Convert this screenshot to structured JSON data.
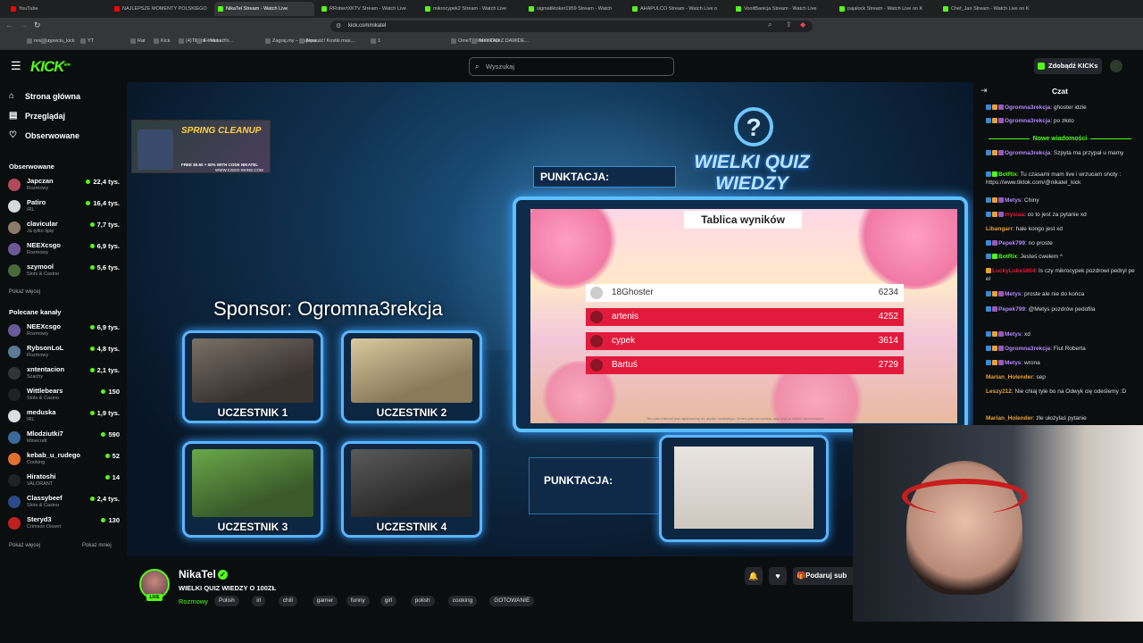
{
  "browser": {
    "tabs": [
      {
        "label": "YouTube",
        "color": "#ff0000"
      },
      {
        "label": "NAJLEPSZE MOMENTY POLSKIEGO",
        "color": "#ff0000"
      },
      {
        "label": "NikaTel Stream - Watch Live",
        "color": "#53fc18",
        "active": true
      },
      {
        "label": "RRobertXKTV Stream - Watch Live",
        "color": "#53fc18"
      },
      {
        "label": "mikrocypek2 Stream - Watch Live",
        "color": "#53fc18"
      },
      {
        "label": "sigmatiktoker1959 Stream - Watch",
        "color": "#53fc18"
      },
      {
        "label": "AHAPULCO Stream - Watch Live o",
        "color": "#53fc18"
      },
      {
        "label": "VooitBanicja Stream - Watch Live",
        "color": "#53fc18"
      },
      {
        "label": "pajalock Stream - Watch Live on K",
        "color": "#53fc18"
      },
      {
        "label": "Chef_Jan Stream - Watch Live on K",
        "color": "#53fc18"
      }
    ],
    "url": "kick.com/nikatel",
    "bookmarks": [
      "nowciu_",
      "nowciu_kick",
      "YT",
      "Rat",
      "Kick",
      "(4)TikTok - Make Yo...",
      "Filman.cc",
      "Zagraj.my – Najlepa...",
      "Nowość! Kostki mas...",
      "1",
      "OmeTV Video Chat...",
      "WYWIAD Z DAWIDE..."
    ]
  },
  "header": {
    "logo": "KICK",
    "logo_sup": "BETA",
    "search_placeholder": "Wyszukaj",
    "kicks_button": "Zdobądź KICKs"
  },
  "sidebar": {
    "nav": [
      {
        "label": "Strona główna",
        "icon": "home-icon"
      },
      {
        "label": "Przeglądaj",
        "icon": "browse-icon"
      },
      {
        "label": "Obserwowane",
        "icon": "heart-icon"
      }
    ],
    "followed_title": "Obserwowane",
    "followed": [
      {
        "name": "Japczan",
        "category": "Rozmowy",
        "viewers": "22,4 tys.",
        "color": "#b04a5a"
      },
      {
        "name": "Patiro",
        "category": "IRL",
        "viewers": "16,4 tys.",
        "color": "#d8d8d8"
      },
      {
        "name": "clavicular",
        "category": "Ja tylko śpię",
        "viewers": "7,7 tys.",
        "color": "#8a7a6a"
      },
      {
        "name": "NEEXcsgo",
        "category": "Rozmowy",
        "viewers": "6,9 tys.",
        "color": "#6a5a9a"
      },
      {
        "name": "szymool",
        "category": "Slots & Casino",
        "viewers": "5,6 tys.",
        "color": "#4a6a3a"
      }
    ],
    "show_more": "Pokaż więcej",
    "recommended_title": "Polecane kanały",
    "recommended": [
      {
        "name": "NEEXcsgo",
        "category": "Rozmowy",
        "viewers": "6,9 tys.",
        "color": "#6a5a9a"
      },
      {
        "name": "RybsonLoL",
        "category": "Rozmowy",
        "viewers": "4,8 tys.",
        "color": "#5a7a9a"
      },
      {
        "name": "xntentacion",
        "category": "Szachy",
        "viewers": "2,1 tys.",
        "color": "#333"
      },
      {
        "name": "Wittlebears",
        "category": "Slots & Casino",
        "viewers": "150",
        "color": "#222"
      },
      {
        "name": "meduska",
        "category": "IRL",
        "viewers": "1,9 tys.",
        "color": "#ddd"
      },
      {
        "name": "Mlodziutki7",
        "category": "Minecraft",
        "viewers": "590",
        "color": "#3a6a9a"
      },
      {
        "name": "kebab_u_rudego",
        "category": "Cooking",
        "viewers": "52",
        "color": "#e07030"
      },
      {
        "name": "Hiratoshi",
        "category": "VALORANT",
        "viewers": "14",
        "color": "#222"
      },
      {
        "name": "Classybeef",
        "category": "Slots & Casino",
        "viewers": "2,4 tys.",
        "color": "#2a4a8a"
      },
      {
        "name": "Steryd3",
        "category": "Crimson Desert",
        "viewers": "130",
        "color": "#c02020"
      }
    ],
    "show_more2": "Pokaż więcej",
    "show_less": "Pokaż mniej"
  },
  "video": {
    "promo_title": "SPRING CLEANUP",
    "promo_line1": "FREE $0.50 + 50% WITH CODE NIKATEL",
    "promo_line2": "WWW.CSGO-SKINS.COM",
    "sponsor": "Sponsor: Ogromna3rekcja",
    "quiz_title": "WIELKI QUIZ WIEDZY",
    "quiz_q": "?",
    "punktacja_1": "PUNKTACJA:",
    "punktacja_2": "PUNKTACJA:",
    "board_title": "Tablica wyników",
    "board_note": "Ten plan Kahoot! jest ograniczony do użytku osobistego. Zmień plan na wyższy, aby użyć w celach biznesowych",
    "leaderboard": [
      {
        "name": "18Ghoster",
        "score": "6234",
        "bg": "#ffffff",
        "fg": "#333333"
      },
      {
        "name": "artenis",
        "score": "4252",
        "bg": "#e21b3c",
        "fg": "#ffffff"
      },
      {
        "name": "cypek",
        "score": "3614",
        "bg": "#e21b3c",
        "fg": "#ffffff"
      },
      {
        "name": "Bartuś",
        "score": "2729",
        "bg": "#e21b3c",
        "fg": "#ffffff"
      }
    ],
    "contestants": [
      "UCZESTNIK 1",
      "UCZESTNIK 2",
      "UCZESTNIK 3",
      "UCZESTNIK 4"
    ]
  },
  "stream": {
    "name": "NikaTel",
    "title": "WIELKI QUIZ WIEDZY O 100ZŁ",
    "category": "Rozmowy",
    "tags": [
      "Polish",
      "irl",
      "chill",
      "gamer",
      "funny",
      "girl",
      "polish",
      "cooking",
      "GOTOWANIE"
    ],
    "live": "LIVE",
    "sub_button": "Podaruj sub"
  },
  "chat": {
    "title": "Czat",
    "new_messages": "Nowe wiadomości",
    "messages": [
      {
        "user": "Ogromna3rekcja",
        "color": "#b388ff",
        "text": ": ghoster idzie",
        "badges": [
          "#3a8bd6",
          "#e8a13a",
          "#9b59b6"
        ]
      },
      {
        "user": "Ogromna3rekcja",
        "color": "#b388ff",
        "text": ": po złoto",
        "badges": [
          "#3a8bd6",
          "#e8a13a",
          "#9b59b6"
        ]
      },
      {
        "user": "Ogromna3rekcja",
        "color": "#b388ff",
        "text": ": Szpyta ma przypał u mamy",
        "badges": [
          "#3a8bd6",
          "#e8a13a",
          "#9b59b6"
        ]
      },
      {
        "user": "BotRix",
        "color": "#53fc18",
        "text": ": Tu czasami mam live i wrzucam shoty : https://www.tiktok.com/@nikatel_kick",
        "badges": [
          "#3a8bd6",
          "#53fc18"
        ]
      },
      {
        "user": "Metys",
        "color": "#b388ff",
        "text": ": Chiny",
        "badges": [
          "#3a8bd6",
          "#e8a13a",
          "#9b59b6"
        ]
      },
      {
        "user": "mysiaa",
        "color": "#e21b3c",
        "text": ": co to jest za pytanie xd",
        "badges": [
          "#3a8bd6",
          "#e8a13a",
          "#9b59b6"
        ]
      },
      {
        "user": "Libangarr",
        "color": "#e8a13a",
        "text": ": hale kongo jest xd",
        "badges": []
      },
      {
        "user": "Pepek799",
        "color": "#b388ff",
        "text": ": no proste",
        "badges": [
          "#3a8bd6",
          "#9b59b6"
        ]
      },
      {
        "user": "BotRix",
        "color": "#53fc18",
        "text": ": Jesteś cwelem ^",
        "badges": [
          "#3a8bd6",
          "#53fc18"
        ]
      },
      {
        "user": "LuckyLuke1604",
        "color": "#e21b3c",
        "text": ": Is czy mikrocypek pozdrowi pedryl pe el",
        "badges": [
          "#e8a13a"
        ]
      },
      {
        "user": "Metys",
        "color": "#b388ff",
        "text": ": proste ale nie do końca",
        "badges": [
          "#3a8bd6",
          "#e8a13a",
          "#9b59b6"
        ]
      },
      {
        "user": "Pepek799",
        "color": "#b388ff",
        "text": ": @Metys pozdrów pedofila",
        "badges": [
          "#3a8bd6",
          "#9b59b6"
        ]
      },
      {
        "user": "Metys",
        "color": "#b388ff",
        "text": ": xd",
        "badges": [
          "#3a8bd6",
          "#e8a13a",
          "#9b59b6"
        ]
      },
      {
        "user": "Ogromna3rekcja",
        "color": "#b388ff",
        "text": ": Fiut Roberta",
        "badges": [
          "#3a8bd6",
          "#e8a13a",
          "#9b59b6"
        ]
      },
      {
        "user": "Metys",
        "color": "#b388ff",
        "text": ": wrona",
        "badges": [
          "#3a8bd6",
          "#e8a13a",
          "#9b59b6"
        ]
      },
      {
        "user": "Marian_Holender",
        "color": "#e8a13a",
        "text": ": sep",
        "badges": []
      },
      {
        "user": "Leszy212",
        "color": "#e8a13a",
        "text": ": Nie chiaj tyle bo na Odwyk cię odeślemy :D",
        "badges": []
      },
      {
        "user": "Marian_Holender",
        "color": "#e8a13a",
        "text": ": źle ułożylaś pytanie",
        "badges": []
      }
    ]
  }
}
